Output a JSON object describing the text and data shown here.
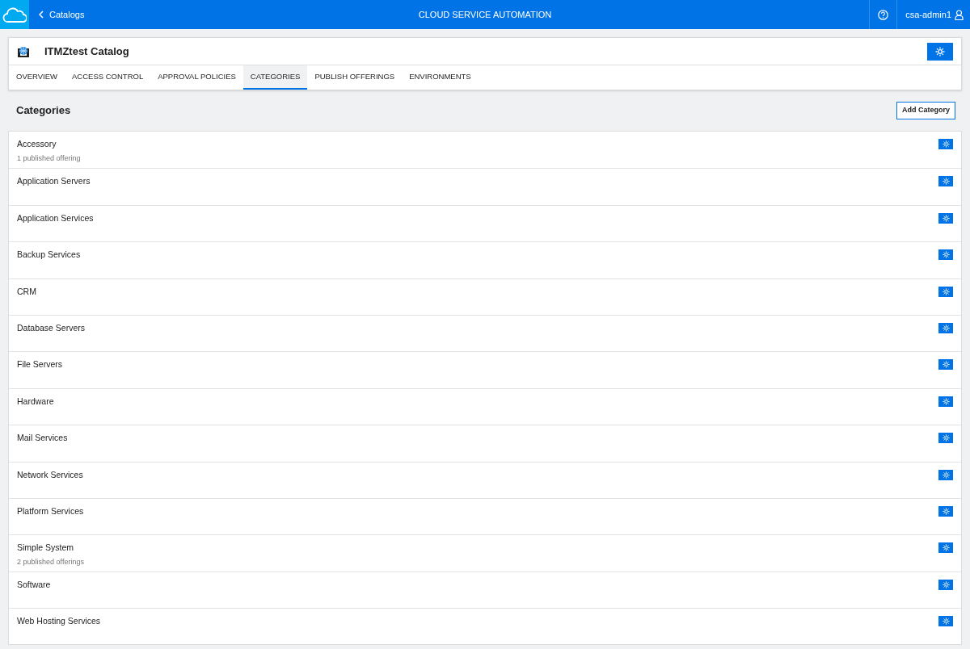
{
  "header": {
    "back_link": "Catalogs",
    "title": "CLOUD SERVICE AUTOMATION",
    "user": "csa-admin1"
  },
  "catalog": {
    "title": "ITMZtest Catalog"
  },
  "tabs": [
    {
      "label": "OVERVIEW",
      "selected": false
    },
    {
      "label": "ACCESS CONTROL",
      "selected": false
    },
    {
      "label": "APPROVAL POLICIES",
      "selected": false
    },
    {
      "label": "CATEGORIES",
      "selected": true
    },
    {
      "label": "PUBLISH OFFERINGS",
      "selected": false
    },
    {
      "label": "ENVIRONMENTS",
      "selected": false
    }
  ],
  "section": {
    "title": "Categories",
    "add_button": "Add Category"
  },
  "categories": [
    {
      "name": "Accessory",
      "detail": "1 published offering"
    },
    {
      "name": "Application Servers"
    },
    {
      "name": "Application Services"
    },
    {
      "name": "Backup Services"
    },
    {
      "name": "CRM"
    },
    {
      "name": "Database Servers"
    },
    {
      "name": "File Servers"
    },
    {
      "name": "Hardware"
    },
    {
      "name": "Mail Services"
    },
    {
      "name": "Network Services"
    },
    {
      "name": "Platform Services"
    },
    {
      "name": "Simple System",
      "detail": "2 published offerings"
    },
    {
      "name": "Software"
    },
    {
      "name": "Web Hosting Services"
    }
  ]
}
